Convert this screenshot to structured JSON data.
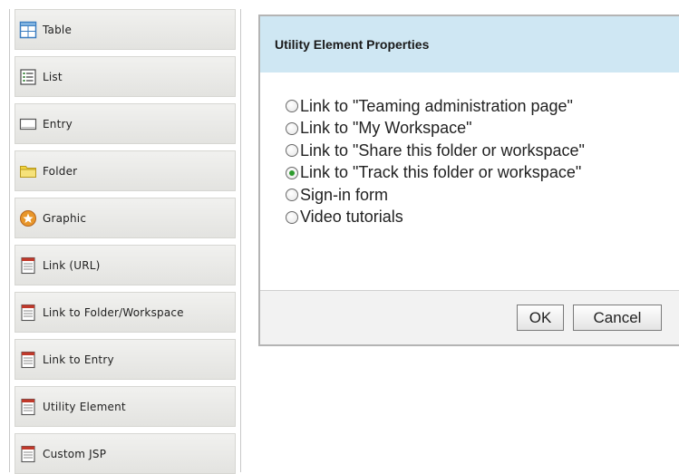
{
  "palette": {
    "items": [
      {
        "label": "Table",
        "icon": "table-icon"
      },
      {
        "label": "List",
        "icon": "list-icon"
      },
      {
        "label": "Entry",
        "icon": "entry-icon"
      },
      {
        "label": "Folder",
        "icon": "folder-icon"
      },
      {
        "label": "Graphic",
        "icon": "graphic-icon"
      },
      {
        "label": "Link (URL)",
        "icon": "link-url-icon"
      },
      {
        "label": "Link to Folder/Workspace",
        "icon": "link-folder-icon"
      },
      {
        "label": "Link to Entry",
        "icon": "link-entry-icon"
      },
      {
        "label": "Utility Element",
        "icon": "utility-element-icon"
      },
      {
        "label": "Custom JSP",
        "icon": "custom-jsp-icon"
      }
    ]
  },
  "dialog": {
    "title": "Utility Element Properties",
    "options": [
      {
        "label": "Link to \"Teaming administration page\"",
        "checked": false
      },
      {
        "label": "Link to \"My Workspace\"",
        "checked": false
      },
      {
        "label": "Link to \"Share this folder or workspace\"",
        "checked": false
      },
      {
        "label": "Link to \"Track this folder or workspace\"",
        "checked": true
      },
      {
        "label": "Sign-in form",
        "checked": false
      },
      {
        "label": "Video tutorials",
        "checked": false
      }
    ],
    "ok_label": "OK",
    "cancel_label": "Cancel"
  },
  "colors": {
    "header_bg": "#cfe7f3",
    "radio_selected": "#2d9b2d",
    "folder_yellow": "#f2d43c",
    "graphic_orange": "#e8962a",
    "doc_red": "#c0392b"
  }
}
